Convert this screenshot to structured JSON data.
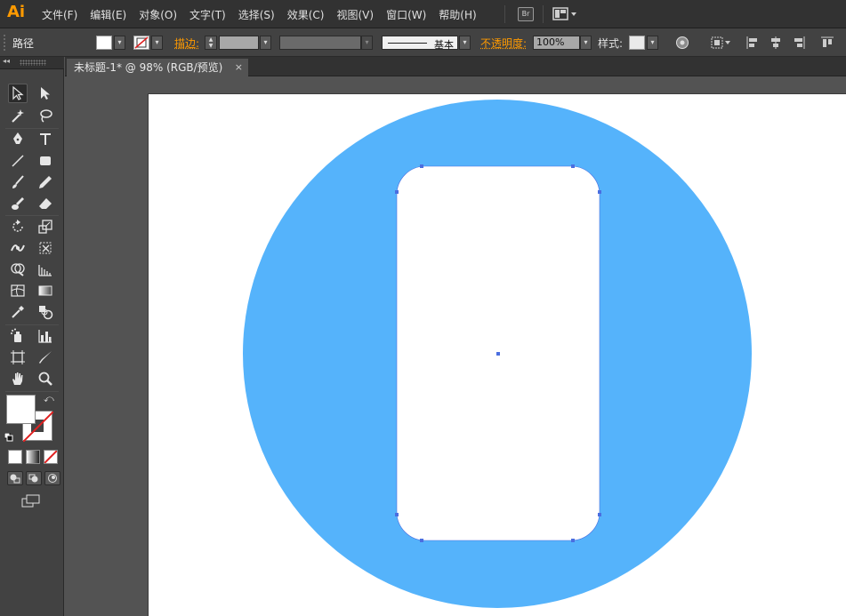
{
  "app": {
    "logo": "Ai",
    "bridge_button": "Br"
  },
  "menu": [
    "文件(F)",
    "编辑(E)",
    "对象(O)",
    "文字(T)",
    "选择(S)",
    "效果(C)",
    "视图(V)",
    "窗口(W)",
    "帮助(H)"
  ],
  "control_bar": {
    "selection_type": "路径",
    "fill_color": "#ffffff",
    "stroke_label": "描边:",
    "stroke_weight": "",
    "brush_label": "基本",
    "opacity_label": "不透明度:",
    "opacity_value": "100%",
    "style_label": "样式:"
  },
  "document": {
    "tab_title": "未标题-1* @ 98% (RGB/预览)",
    "close_glyph": "×"
  },
  "artwork": {
    "circle_color": "#55b3fb",
    "phone_body_color": "#ffffff",
    "selection_color": "#4a6ee0"
  },
  "tools": [
    "selection-tool",
    "direct-selection-tool",
    "magic-wand-tool",
    "lasso-tool",
    "pen-tool",
    "type-tool",
    "line-tool",
    "rectangle-tool",
    "paintbrush-tool",
    "pencil-tool",
    "blob-brush-tool",
    "eraser-tool",
    "rotate-tool",
    "scale-tool",
    "width-tool",
    "free-transform-tool",
    "shape-builder-tool",
    "perspective-grid-tool",
    "mesh-tool",
    "gradient-tool",
    "eyedropper-tool",
    "blend-tool",
    "symbol-sprayer-tool",
    "column-graph-tool",
    "artboard-tool",
    "slice-tool",
    "hand-tool",
    "zoom-tool"
  ]
}
